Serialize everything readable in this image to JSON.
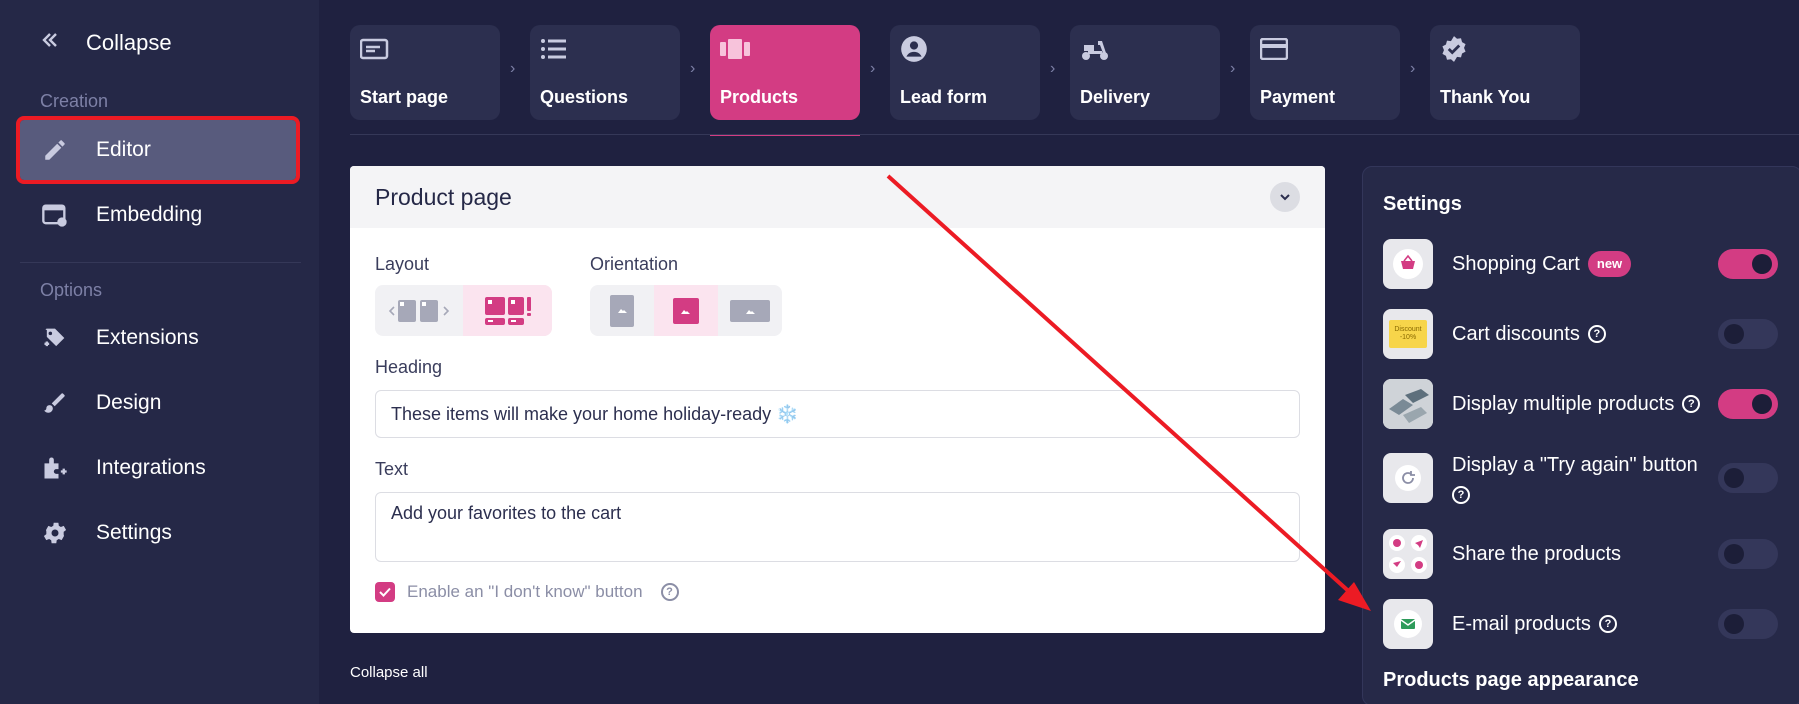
{
  "sidebar": {
    "collapse_label": "Collapse",
    "section_creation": "Creation",
    "section_options": "Options",
    "items": [
      {
        "label": "Editor",
        "icon": "pencil-icon"
      },
      {
        "label": "Embedding",
        "icon": "embed-icon"
      },
      {
        "label": "Extensions",
        "icon": "puzzle-icon"
      },
      {
        "label": "Design",
        "icon": "brush-icon"
      },
      {
        "label": "Integrations",
        "icon": "integrations-icon"
      },
      {
        "label": "Settings",
        "icon": "gear-icon"
      }
    ]
  },
  "steps": [
    {
      "label": "Start page",
      "icon": "start-page-icon"
    },
    {
      "label": "Questions",
      "icon": "list-icon"
    },
    {
      "label": "Products",
      "icon": "products-icon"
    },
    {
      "label": "Lead form",
      "icon": "user-icon"
    },
    {
      "label": "Delivery",
      "icon": "scooter-icon"
    },
    {
      "label": "Payment",
      "icon": "card-icon"
    },
    {
      "label": "Thank You",
      "icon": "verified-icon"
    }
  ],
  "product_card": {
    "title": "Product page",
    "layout_label": "Layout",
    "orientation_label": "Orientation",
    "heading_label": "Heading",
    "heading_value": "These items will make your home holiday-ready ❄️",
    "text_label": "Text",
    "text_value": "Add your favorites to the cart",
    "dont_know_label": "Enable an \"I don't know\" button",
    "dont_know_checked": true,
    "help_glyph": "?"
  },
  "collapse_all": "Collapse all",
  "settings": {
    "title": "Settings",
    "new_badge": "new",
    "items": [
      {
        "label": "Shopping Cart",
        "on": true
      },
      {
        "label": "Cart discounts",
        "on": false,
        "thumb_text_1": "Discount",
        "thumb_text_2": "-10%"
      },
      {
        "label": "Display multiple products",
        "on": true
      },
      {
        "label": "Display a \"Try again\" button",
        "on": false
      },
      {
        "label": "Share the products",
        "on": false
      },
      {
        "label": "E-mail products",
        "on": false
      }
    ],
    "appearance_title": "Products page appearance"
  },
  "colors": {
    "accent": "#d33c83",
    "sidebar_bg": "#252847",
    "page_bg": "#1f2140",
    "highlight": "#ec1b24"
  }
}
